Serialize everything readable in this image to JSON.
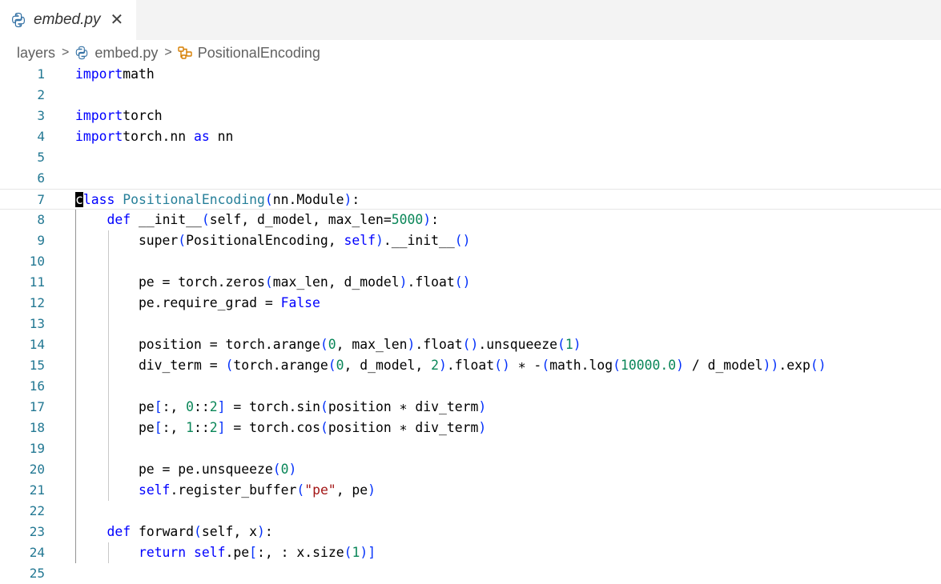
{
  "tab": {
    "title": "embed.py",
    "close_glyph": "✕",
    "icon": "python-file-icon"
  },
  "breadcrumb": {
    "folder": "layers",
    "file": "embed.py",
    "symbol": "PositionalEncoding",
    "separator": ">",
    "file_icon": "python-file-icon",
    "symbol_icon": "class-symbol-icon"
  },
  "editor": {
    "current_line": 7,
    "lines": [
      {
        "n": "1",
        "tokens": [
          [
            "kw",
            "import"
          ],
          [
            "",
            "math"
          ]
        ]
      },
      {
        "n": "2",
        "tokens": []
      },
      {
        "n": "3",
        "tokens": [
          [
            "kw",
            "import"
          ],
          [
            "",
            "torch"
          ]
        ]
      },
      {
        "n": "4",
        "tokens": [
          [
            "kw",
            "import"
          ],
          [
            "",
            "torch.nn "
          ],
          [
            "kw",
            "as"
          ],
          [
            "",
            " nn"
          ]
        ]
      },
      {
        "n": "5",
        "tokens": []
      },
      {
        "n": "6",
        "tokens": []
      },
      {
        "n": "7",
        "tokens": [
          [
            "cursor",
            "c"
          ],
          [
            "kw",
            "lass"
          ],
          [
            "",
            " "
          ],
          [
            "ty",
            "PositionalEncoding"
          ],
          [
            "bp",
            "("
          ],
          [
            "",
            "nn.Module"
          ],
          [
            "bp",
            ")"
          ],
          [
            "",
            ":"
          ]
        ]
      },
      {
        "n": "8",
        "tokens": [
          [
            "",
            "    "
          ],
          [
            "kw",
            "def"
          ],
          [
            "",
            " __init__"
          ],
          [
            "bp",
            "("
          ],
          [
            "",
            "self, d_model, max_len="
          ],
          [
            "num",
            "5000"
          ],
          [
            "bp",
            ")"
          ],
          [
            "",
            ":"
          ]
        ]
      },
      {
        "n": "9",
        "tokens": [
          [
            "",
            "        super"
          ],
          [
            "bp",
            "("
          ],
          [
            "",
            "PositionalEncoding, "
          ],
          [
            "kw",
            "self"
          ],
          [
            "bp",
            ")"
          ],
          [
            "",
            ".__init__"
          ],
          [
            "bp",
            "()"
          ]
        ]
      },
      {
        "n": "10",
        "tokens": []
      },
      {
        "n": "11",
        "tokens": [
          [
            "",
            "        pe = torch.zeros"
          ],
          [
            "bp",
            "("
          ],
          [
            "",
            "max_len, d_model"
          ],
          [
            "bp",
            ")"
          ],
          [
            "",
            ".float"
          ],
          [
            "bp",
            "()"
          ]
        ]
      },
      {
        "n": "12",
        "tokens": [
          [
            "",
            "        pe.require_grad = "
          ],
          [
            "kw",
            "False"
          ]
        ]
      },
      {
        "n": "13",
        "tokens": []
      },
      {
        "n": "14",
        "tokens": [
          [
            "",
            "        position = torch.arange"
          ],
          [
            "bp",
            "("
          ],
          [
            "num",
            "0"
          ],
          [
            "",
            ", max_len"
          ],
          [
            "bp",
            ")"
          ],
          [
            "",
            ".float"
          ],
          [
            "bp",
            "()"
          ],
          [
            "",
            ".unsqueeze"
          ],
          [
            "bp",
            "("
          ],
          [
            "num",
            "1"
          ],
          [
            "bp",
            ")"
          ]
        ]
      },
      {
        "n": "15",
        "tokens": [
          [
            "",
            "        div_term = "
          ],
          [
            "bp",
            "("
          ],
          [
            "",
            "torch.arange"
          ],
          [
            "bp",
            "("
          ],
          [
            "num",
            "0"
          ],
          [
            "",
            ", d_model, "
          ],
          [
            "num",
            "2"
          ],
          [
            "bp",
            ")"
          ],
          [
            "",
            ".float"
          ],
          [
            "bp",
            "()"
          ],
          [
            "",
            " ∗ -"
          ],
          [
            "bp",
            "("
          ],
          [
            "",
            "math.log"
          ],
          [
            "bp",
            "("
          ],
          [
            "num",
            "10000.0"
          ],
          [
            "bp",
            ")"
          ],
          [
            "",
            " / d_model"
          ],
          [
            "bp",
            "))"
          ],
          [
            "",
            ".exp"
          ],
          [
            "bp",
            "()"
          ]
        ]
      },
      {
        "n": "16",
        "tokens": []
      },
      {
        "n": "17",
        "tokens": [
          [
            "",
            "        pe"
          ],
          [
            "bp",
            "["
          ],
          [
            "",
            ":, "
          ],
          [
            "num",
            "0"
          ],
          [
            "",
            "::"
          ],
          [
            "num",
            "2"
          ],
          [
            "bp",
            "]"
          ],
          [
            "",
            " = torch.sin"
          ],
          [
            "bp",
            "("
          ],
          [
            "",
            "position ∗ div_term"
          ],
          [
            "bp",
            ")"
          ]
        ]
      },
      {
        "n": "18",
        "tokens": [
          [
            "",
            "        pe"
          ],
          [
            "bp",
            "["
          ],
          [
            "",
            ":, "
          ],
          [
            "num",
            "1"
          ],
          [
            "",
            "::"
          ],
          [
            "num",
            "2"
          ],
          [
            "bp",
            "]"
          ],
          [
            "",
            " = torch.cos"
          ],
          [
            "bp",
            "("
          ],
          [
            "",
            "position ∗ div_term"
          ],
          [
            "bp",
            ")"
          ]
        ]
      },
      {
        "n": "19",
        "tokens": []
      },
      {
        "n": "20",
        "tokens": [
          [
            "",
            "        pe = pe.unsqueeze"
          ],
          [
            "bp",
            "("
          ],
          [
            "num",
            "0"
          ],
          [
            "bp",
            ")"
          ]
        ]
      },
      {
        "n": "21",
        "tokens": [
          [
            "",
            "        "
          ],
          [
            "kw",
            "self"
          ],
          [
            "",
            ".register_buffer"
          ],
          [
            "bp",
            "("
          ],
          [
            "str",
            "\"pe\""
          ],
          [
            "",
            ", pe"
          ],
          [
            "bp",
            ")"
          ]
        ]
      },
      {
        "n": "22",
        "tokens": []
      },
      {
        "n": "23",
        "tokens": [
          [
            "",
            "    "
          ],
          [
            "kw",
            "def"
          ],
          [
            "",
            " forward"
          ],
          [
            "bp",
            "("
          ],
          [
            "",
            "self, x"
          ],
          [
            "bp",
            ")"
          ],
          [
            "",
            ":"
          ]
        ]
      },
      {
        "n": "24",
        "tokens": [
          [
            "",
            "        "
          ],
          [
            "kw",
            "return"
          ],
          [
            "",
            " "
          ],
          [
            "kw",
            "self"
          ],
          [
            "",
            ".pe"
          ],
          [
            "bp",
            "["
          ],
          [
            "",
            ":, : x.size"
          ],
          [
            "bp",
            "("
          ],
          [
            "num",
            "1"
          ],
          [
            "bp",
            ")]"
          ]
        ]
      },
      {
        "n": "25",
        "tokens": []
      }
    ]
  }
}
